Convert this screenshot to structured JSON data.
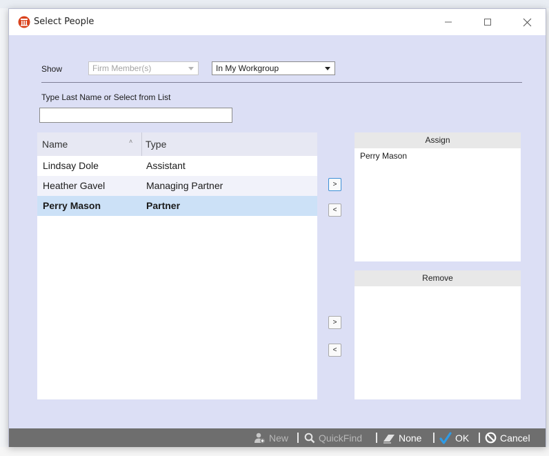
{
  "window": {
    "title": "Select People",
    "controls": {
      "minimize_icon": "minimize-icon",
      "maximize_icon": "maximize-icon",
      "close_icon": "close-icon"
    }
  },
  "filters": {
    "show_label": "Show",
    "member_type": {
      "selected": "Firm Member(s)",
      "enabled": false
    },
    "scope": {
      "selected": "In My Workgroup",
      "enabled": true
    }
  },
  "search": {
    "label": "Type Last Name or Select from List",
    "value": ""
  },
  "people_list": {
    "columns": [
      {
        "label": "Name",
        "sort": "ascending"
      },
      {
        "label": "Type"
      }
    ],
    "rows": [
      {
        "name": "Lindsay Dole",
        "type": "Assistant",
        "selected": false
      },
      {
        "name": "Heather Gavel",
        "type": "Managing Partner",
        "selected": false
      },
      {
        "name": "Perry Mason",
        "type": "Partner",
        "selected": true
      }
    ]
  },
  "assign_panel": {
    "title": "Assign",
    "items": [
      "Perry Mason"
    ]
  },
  "remove_panel": {
    "title": "Remove",
    "items": []
  },
  "move_buttons": {
    "add": ">",
    "remove": "<"
  },
  "footer": {
    "new_label": "New",
    "quickfind_label": "QuickFind",
    "none_label": "None",
    "ok_label": "OK",
    "cancel_label": "Cancel"
  },
  "colors": {
    "dialog_bg": "#dcdff5",
    "selection": "#cce1f7",
    "footer_bg": "#6e6e6e",
    "ok_check": "#2e9be6",
    "app_icon": "#d9421c"
  }
}
